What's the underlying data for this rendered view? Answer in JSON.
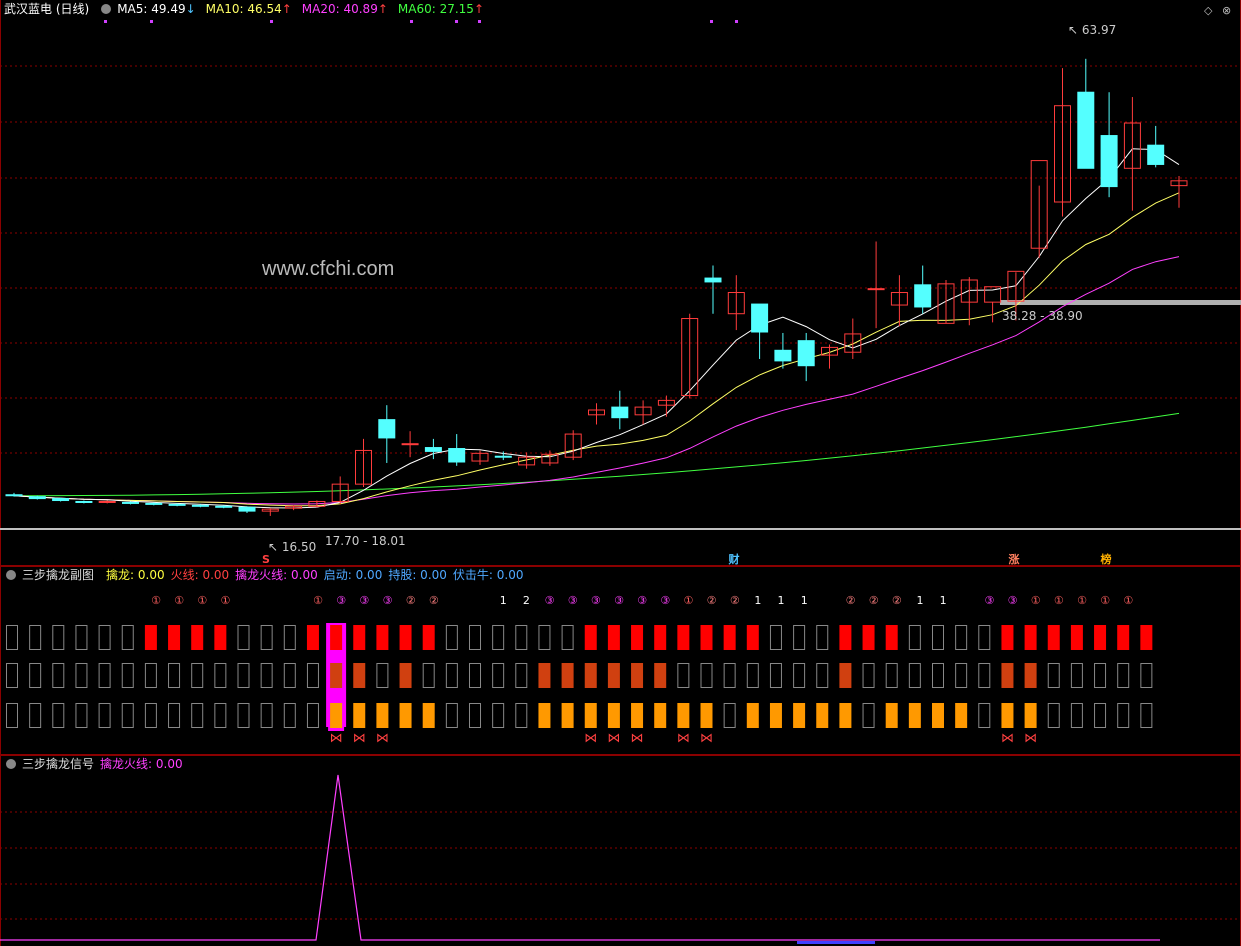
{
  "main": {
    "title": "武汉蓝电 (日线)",
    "ma": [
      {
        "label": "MA5: 49.49",
        "arrow": "↓",
        "color": "#ffffff",
        "arrow_color": "#4fc3ff"
      },
      {
        "label": "MA10: 46.54",
        "arrow": "↑",
        "color": "#ffff66",
        "arrow_color": "#ff4040"
      },
      {
        "label": "MA20: 40.89",
        "arrow": "↑",
        "color": "#ff40ff",
        "arrow_color": "#ff4040"
      },
      {
        "label": "MA60: 27.15",
        "arrow": "↑",
        "color": "#40ff40",
        "arrow_color": "#ff4040"
      }
    ],
    "watermark": "www.cfchi.com",
    "hi_label": "63.97",
    "lo_label": "16.50",
    "range1": "17.70 - 18.01",
    "range2": "38.28 - 38.90",
    "markers": [
      {
        "text": "S",
        "color": "#ff4040"
      },
      {
        "text": "财",
        "color": "#4fc3ff"
      },
      {
        "text": "涨",
        "color": "#ff8060"
      },
      {
        "text": "榜",
        "color": "#ffb000"
      }
    ],
    "controls": {
      "diamond": "◇",
      "close": "⊗"
    }
  },
  "sub": {
    "title": "三步擒龙副图",
    "legend": [
      {
        "label": "擒龙: 0.00",
        "color": "#ffff40"
      },
      {
        "label": "火线: 0.00",
        "color": "#ff4040"
      },
      {
        "label": "擒龙火线: 0.00",
        "color": "#ff40ff"
      },
      {
        "label": "启动: 0.00",
        "color": "#4fa8ff"
      },
      {
        "label": "持股: 0.00",
        "color": "#4fa8ff"
      },
      {
        "label": "伏击牛: 0.00",
        "color": "#4fa8ff"
      }
    ],
    "circle_labels": [
      "①",
      "①",
      "①",
      "①",
      "",
      "",
      "",
      "①",
      "③",
      "③",
      "③",
      "②",
      "②",
      "",
      "",
      "1",
      "2",
      "③",
      "③",
      "③",
      "③",
      "③",
      "③",
      "①",
      "②",
      "②",
      "1",
      "1",
      "1",
      "",
      "②",
      "②",
      "②",
      "1",
      "1",
      "",
      "③",
      "③",
      "①",
      "①",
      "①",
      "①",
      "①"
    ],
    "plain_label_indices": [
      15,
      16,
      26,
      27,
      28,
      33,
      34
    ],
    "row1": [
      0,
      0,
      0,
      0,
      0,
      0,
      1,
      1,
      1,
      1,
      0,
      0,
      0,
      1,
      1,
      1,
      1,
      1,
      1,
      0,
      0,
      0,
      0,
      0,
      0,
      1,
      1,
      1,
      1,
      1,
      1,
      1,
      1,
      0,
      0,
      0,
      1,
      1,
      1,
      0,
      0,
      0,
      0,
      1,
      1,
      1,
      1,
      1,
      1,
      1
    ],
    "row2": [
      0,
      0,
      0,
      0,
      0,
      0,
      0,
      0,
      0,
      0,
      0,
      0,
      0,
      0,
      2,
      1,
      0,
      1,
      0,
      0,
      0,
      0,
      0,
      1,
      1,
      1,
      1,
      1,
      1,
      0,
      0,
      0,
      0,
      0,
      0,
      0,
      1,
      0,
      0,
      0,
      0,
      0,
      0,
      1,
      1,
      0,
      0,
      0,
      0,
      0
    ],
    "row3": [
      0,
      0,
      0,
      0,
      0,
      0,
      0,
      0,
      0,
      0,
      0,
      0,
      0,
      0,
      2,
      1,
      1,
      1,
      1,
      0,
      0,
      0,
      0,
      1,
      1,
      1,
      1,
      1,
      1,
      1,
      1,
      0,
      1,
      1,
      1,
      1,
      1,
      0,
      1,
      1,
      1,
      1,
      0,
      1,
      1,
      0,
      0,
      0,
      0,
      0
    ],
    "butterflies": [
      14,
      15,
      16,
      25,
      26,
      27,
      29,
      30,
      43,
      44
    ]
  },
  "signal": {
    "title": "三步擒龙信号",
    "legend": "擒龙火线: 0.00",
    "legend_color": "#ff40ff"
  },
  "chart_data": {
    "type": "candlestick",
    "series_name": "武汉蓝电 (日线)",
    "candles": [
      [
        18.7,
        18.9,
        18.5,
        18.6
      ],
      [
        18.5,
        18.6,
        18.2,
        18.3
      ],
      [
        18.3,
        18.4,
        18.0,
        18.1
      ],
      [
        18.0,
        18.1,
        17.8,
        17.9
      ],
      [
        17.9,
        18.1,
        17.8,
        18.0
      ],
      [
        17.9,
        18.0,
        17.7,
        17.8
      ],
      [
        17.8,
        17.9,
        17.6,
        17.7
      ],
      [
        17.7,
        17.8,
        17.5,
        17.6
      ],
      [
        17.6,
        17.7,
        17.4,
        17.5
      ],
      [
        17.5,
        17.6,
        17.3,
        17.4
      ],
      [
        17.4,
        17.5,
        16.8,
        17.0
      ],
      [
        17.0,
        17.3,
        16.5,
        17.2
      ],
      [
        17.3,
        17.6,
        17.1,
        17.5
      ],
      [
        17.5,
        18.1,
        17.4,
        18.0
      ],
      [
        18.0,
        20.6,
        17.7,
        19.8
      ],
      [
        19.8,
        24.5,
        19.5,
        23.3
      ],
      [
        26.5,
        28.0,
        22.0,
        24.6
      ],
      [
        24.0,
        25.3,
        22.6,
        24.0
      ],
      [
        23.6,
        24.5,
        22.4,
        23.2
      ],
      [
        23.5,
        25.0,
        21.7,
        22.1
      ],
      [
        22.2,
        23.3,
        21.8,
        23.0
      ],
      [
        22.7,
        23.2,
        22.3,
        22.6
      ],
      [
        21.8,
        23.1,
        21.4,
        22.6
      ],
      [
        22.0,
        23.3,
        21.7,
        22.9
      ],
      [
        22.6,
        25.4,
        22.3,
        25.0
      ],
      [
        27.0,
        28.2,
        26.0,
        27.5
      ],
      [
        27.8,
        29.5,
        25.5,
        26.7
      ],
      [
        27.0,
        28.5,
        26.0,
        27.8
      ],
      [
        28.0,
        29.0,
        26.8,
        28.5
      ],
      [
        29.0,
        37.5,
        28.7,
        37.0
      ],
      [
        41.2,
        42.5,
        37.5,
        40.8
      ],
      [
        37.5,
        41.5,
        35.8,
        39.7
      ],
      [
        38.5,
        38.5,
        32.8,
        35.6
      ],
      [
        33.7,
        35.5,
        31.8,
        32.6
      ],
      [
        34.7,
        35.5,
        30.5,
        32.1
      ],
      [
        33.2,
        34.3,
        31.8,
        34.0
      ],
      [
        33.5,
        37.0,
        32.8,
        35.4
      ],
      [
        40.0,
        45.0,
        36.0,
        40.1
      ],
      [
        38.4,
        41.5,
        36.2,
        39.7
      ],
      [
        40.5,
        42.5,
        37.5,
        38.2
      ],
      [
        36.5,
        41.0,
        36.5,
        40.6
      ],
      [
        38.7,
        41.3,
        36.3,
        41.0
      ],
      [
        38.7,
        38.7,
        36.6,
        40.3
      ],
      [
        38.8,
        41.8,
        36.8,
        41.9
      ],
      [
        44.3,
        50.8,
        43.3,
        53.4
      ],
      [
        49.1,
        63.0,
        47.6,
        59.1
      ],
      [
        60.5,
        63.97,
        55.0,
        52.6
      ],
      [
        56.0,
        60.5,
        49.6,
        50.7
      ],
      [
        52.6,
        60.0,
        48.2,
        57.3
      ],
      [
        55.0,
        57.0,
        52.7,
        53.0
      ],
      [
        50.8,
        51.8,
        48.5,
        51.3
      ]
    ],
    "ma5_end": 49.49,
    "ma10_end": 46.54,
    "ma20_end": 40.89,
    "ma60_end": 27.15,
    "signal_values": [
      0,
      0,
      0,
      0,
      0,
      0,
      0,
      0,
      0,
      0,
      0,
      0,
      0,
      0,
      1,
      0,
      0,
      0,
      0,
      0,
      0,
      0,
      0,
      0,
      0,
      0,
      0,
      0,
      0,
      0,
      0,
      0,
      0,
      0,
      0,
      0,
      0,
      0,
      0,
      0,
      0,
      0,
      0,
      0,
      0,
      0,
      0,
      0,
      0,
      0,
      0
    ],
    "ylim": [
      14,
      68
    ],
    "colors": {
      "up": "#ff3c3c",
      "down": "#54ffff",
      "ma5": "#ffffff",
      "ma10": "#ffff66",
      "ma20": "#ff40ff",
      "ma60": "#40ff40",
      "grid": "#8b0000"
    }
  }
}
